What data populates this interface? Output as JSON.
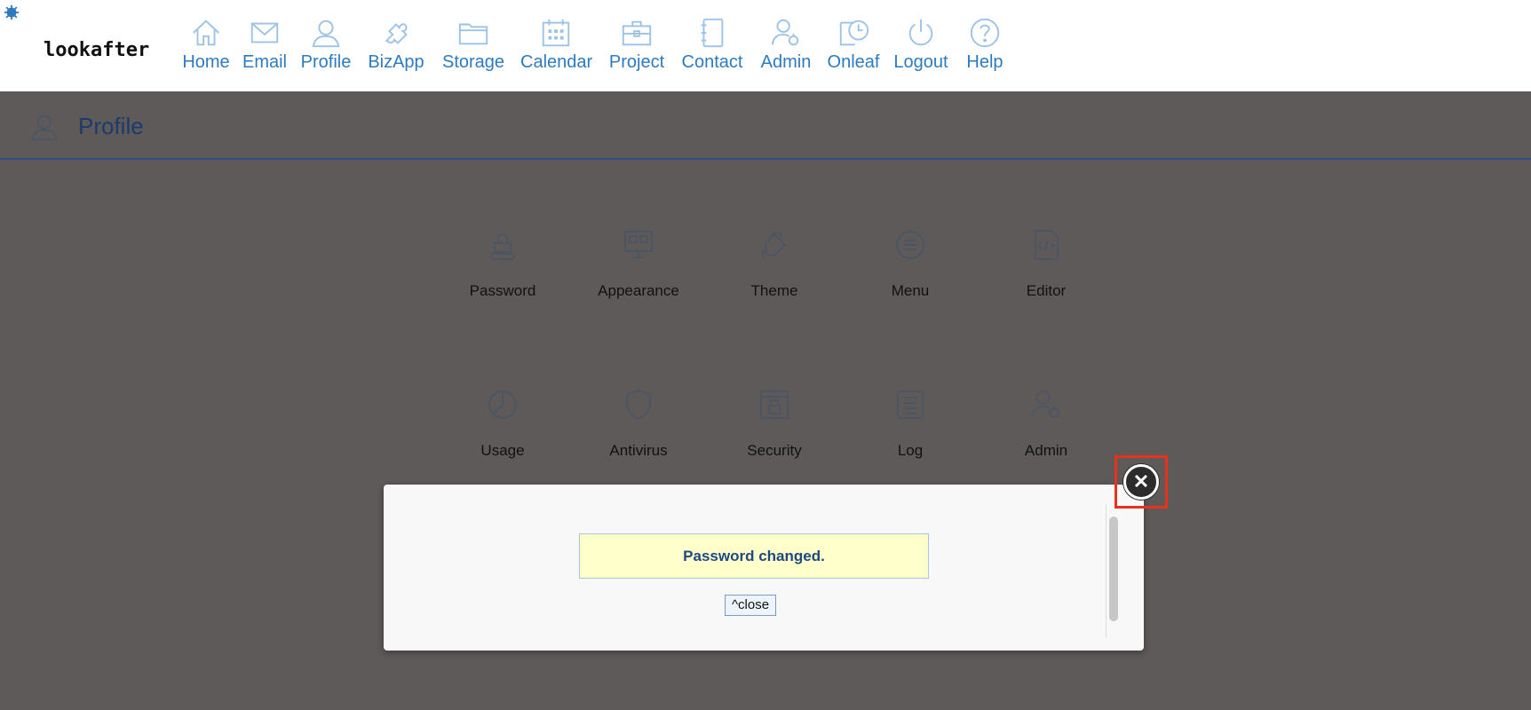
{
  "brand": {
    "logo_text": "lookafter",
    "corner_icon": "gear-badge-icon"
  },
  "nav": [
    {
      "label": "Home",
      "icon": "home-icon"
    },
    {
      "label": "Email",
      "icon": "envelope-icon"
    },
    {
      "label": "Profile",
      "icon": "person-icon"
    },
    {
      "label": "BizApp",
      "icon": "puzzle-icon"
    },
    {
      "label": "Storage",
      "icon": "folder-icon"
    },
    {
      "label": "Calendar",
      "icon": "calendar-icon"
    },
    {
      "label": "Project",
      "icon": "briefcase-icon"
    },
    {
      "label": "Contact",
      "icon": "address-book-icon"
    },
    {
      "label": "Admin",
      "icon": "admin-user-icon"
    },
    {
      "label": "Onleaf",
      "icon": "clock-icon"
    },
    {
      "label": "Logout",
      "icon": "power-icon"
    },
    {
      "label": "Help",
      "icon": "question-icon"
    }
  ],
  "page": {
    "title": "Profile"
  },
  "grid": [
    {
      "label": "Password",
      "icon": "lock-icon"
    },
    {
      "label": "Appearance",
      "icon": "monitor-icon"
    },
    {
      "label": "Theme",
      "icon": "paint-bucket-icon"
    },
    {
      "label": "Menu",
      "icon": "menu-icon"
    },
    {
      "label": "Editor",
      "icon": "code-file-icon"
    },
    {
      "label": "Usage",
      "icon": "pie-chart-icon"
    },
    {
      "label": "Antivirus",
      "icon": "shield-icon"
    },
    {
      "label": "Security",
      "icon": "security-window-icon"
    },
    {
      "label": "Log",
      "icon": "log-list-icon"
    },
    {
      "label": "Admin",
      "icon": "admin-user-icon"
    }
  ],
  "modal": {
    "message": "Password changed.",
    "close_label": "^close",
    "close_icon": "close-x-icon",
    "close_symbol": "✕"
  },
  "colors": {
    "nav_accent": "#2d7bbf",
    "overlay": "#5e5a59",
    "message_bg": "#ffffcc",
    "highlight": "#e8321f"
  }
}
